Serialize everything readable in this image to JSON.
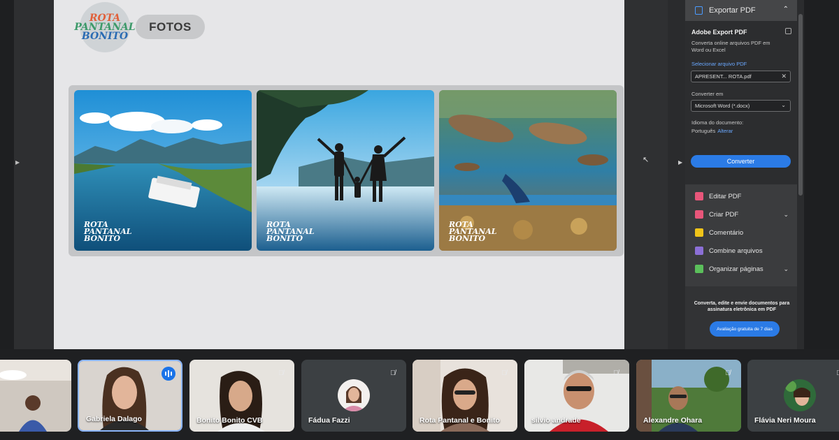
{
  "document": {
    "logo_lines": [
      "ROTA",
      "PANTANAL",
      "BONITO"
    ],
    "section_pill": "FOTOS",
    "photos": [
      {
        "name": "boat-river-photo",
        "watermark": [
          "ROTA",
          "PANTANAL",
          "BONITO"
        ]
      },
      {
        "name": "family-silhouette-photo",
        "watermark": [
          "ROTA",
          "PANTANAL",
          "BONITO"
        ]
      },
      {
        "name": "underwater-fish-photo",
        "watermark": [
          "ROTA",
          "PANTANAL",
          "BONITO"
        ]
      }
    ]
  },
  "acrobat_panel": {
    "header_label": "Exportar PDF",
    "card_title": "Adobe Export PDF",
    "description": "Converta online arquivos PDF em Word ou Excel",
    "select_file_link": "Selecionar arquivo PDF",
    "file_name": "APRESENT... ROTA.pdf",
    "convert_to_label": "Converter em",
    "format_selected": "Microsoft Word (*.docx)",
    "doc_language_label": "Idioma do documento:",
    "doc_language_value": "Português",
    "change_link": "Alterar",
    "convert_button": "Converter",
    "tools": [
      {
        "label": "Editar PDF",
        "icon": "edit-pdf-icon",
        "color": "#e8567a",
        "expandable": false
      },
      {
        "label": "Criar PDF",
        "icon": "create-pdf-icon",
        "color": "#e8567a",
        "expandable": true
      },
      {
        "label": "Comentário",
        "icon": "comment-icon",
        "color": "#f0c419",
        "expandable": false
      },
      {
        "label": "Combine arquivos",
        "icon": "combine-files-icon",
        "color": "#8b6fd6",
        "expandable": false
      },
      {
        "label": "Organizar páginas",
        "icon": "organize-pages-icon",
        "color": "#5bbf5b",
        "expandable": true
      }
    ],
    "promo_text": "Converta, edite e envie documentos para assinatura eletrônica em PDF",
    "trial_button": "Avaliação gratuita de 7 dias"
  },
  "participants": [
    {
      "name": "",
      "state": "camera",
      "muted": false
    },
    {
      "name": "Gabriela Dalago",
      "state": "camera",
      "speaking": true
    },
    {
      "name": "Bonito Bonito CVB",
      "state": "camera",
      "muted": true
    },
    {
      "name": "Fádua Fazzi",
      "state": "avatar",
      "muted": true
    },
    {
      "name": "Rota Pantanal e Bonito",
      "state": "camera",
      "muted": true
    },
    {
      "name": "silvio andrade",
      "state": "camera",
      "muted": true
    },
    {
      "name": "Alexandre Ohara",
      "state": "camera",
      "muted": true
    },
    {
      "name": "Flávia Neri Moura",
      "state": "avatar",
      "muted": true
    }
  ],
  "colors": {
    "accent": "#2b7be6",
    "active_tile": "#8ab4f8",
    "speaking": "#1a73e8"
  }
}
